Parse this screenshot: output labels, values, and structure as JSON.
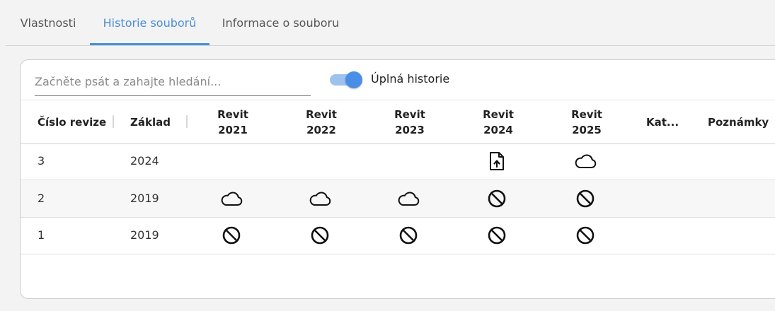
{
  "tabs": [
    {
      "label": "Vlastnosti",
      "active": false
    },
    {
      "label": "Historie souborů",
      "active": true
    },
    {
      "label": "Informace o souboru",
      "active": false
    }
  ],
  "search": {
    "placeholder": "Začněte psát a zahajte hledání...",
    "value": ""
  },
  "toggle": {
    "label": "Úplná historie",
    "on": true
  },
  "table": {
    "columns": {
      "revision": "Číslo revize",
      "base": "Základ",
      "revit2021": {
        "line1": "Revit",
        "line2": "2021"
      },
      "revit2022": {
        "line1": "Revit",
        "line2": "2022"
      },
      "revit2023": {
        "line1": "Revit",
        "line2": "2023"
      },
      "revit2024": {
        "line1": "Revit",
        "line2": "2024"
      },
      "revit2025": {
        "line1": "Revit",
        "line2": "2025"
      },
      "category": "Kat...",
      "notes": "Poznámky"
    },
    "rows": [
      {
        "revision": "3",
        "base": "2024",
        "icons": [
          "",
          "",
          "",
          "file-upload-icon",
          "cloud-icon"
        ]
      },
      {
        "revision": "2",
        "base": "2019",
        "icons": [
          "cloud-icon",
          "cloud-icon",
          "cloud-icon",
          "unavailable-icon",
          "unavailable-icon"
        ]
      },
      {
        "revision": "1",
        "base": "2019",
        "icons": [
          "unavailable-icon",
          "unavailable-icon",
          "unavailable-icon",
          "unavailable-icon",
          "unavailable-icon"
        ]
      }
    ]
  },
  "colors": {
    "accent": "#4a8fd8",
    "toggle_track": "#9dc2ef",
    "toggle_thumb": "#4a8fe5"
  }
}
